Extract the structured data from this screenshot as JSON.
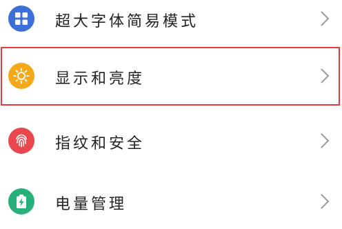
{
  "settings": {
    "items": [
      {
        "label": "超大字体简易模式",
        "icon": "grid-icon",
        "color": "#3d6fd8"
      },
      {
        "label": "显示和亮度",
        "icon": "sun-icon",
        "color": "#f4a81a",
        "highlighted": true
      },
      {
        "label": "指纹和安全",
        "icon": "fingerprint-icon",
        "color": "#e8484d"
      },
      {
        "label": "电量管理",
        "icon": "battery-icon",
        "color": "#27b07a"
      }
    ],
    "highlight_color": "#e8393f",
    "chevron": "chevron-right-icon"
  }
}
